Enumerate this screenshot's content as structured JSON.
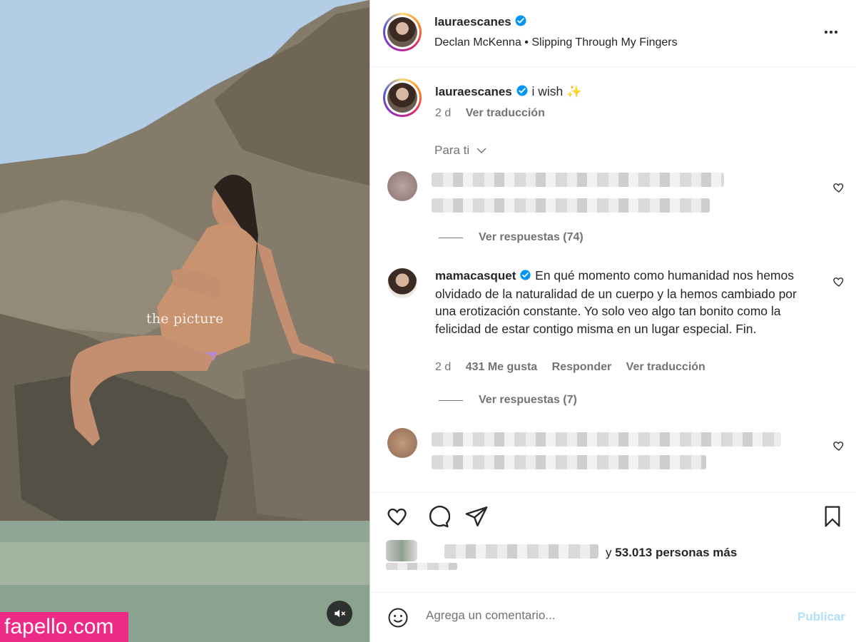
{
  "media": {
    "overlay_text": "the picture",
    "watermark": "fapello.com",
    "mute_icon": "speaker-muted-icon"
  },
  "header": {
    "username": "lauraescanes",
    "song": "Declan McKenna • Slipping Through My Fingers",
    "more_icon": "more-dots-icon"
  },
  "caption": {
    "username": "lauraescanes",
    "text": "i wish ✨",
    "time": "2 d",
    "translate": "Ver traducción"
  },
  "filter_label": "Para ti",
  "comments": [
    {
      "blurred": true,
      "view_replies": "Ver respuestas (74)"
    },
    {
      "username": "mamacasquet",
      "text": "En qué momento como humanidad nos hemos olvidado de la naturalidad de un cuerpo y la hemos cambiado por una erotización constante. Yo solo veo algo tan bonito como la felicidad de estar contigo misma en un lugar especial. Fin.",
      "time": "2 d",
      "likes": "431 Me gusta",
      "reply": "Responder",
      "translate": "Ver traducción",
      "view_replies": "Ver respuestas (7)"
    },
    {
      "blurred": true
    }
  ],
  "likes": {
    "suffix": "y",
    "count_text": "53.013 personas más"
  },
  "add_comment": {
    "placeholder": "Agrega un comentario...",
    "publish": "Publicar"
  },
  "colors": {
    "verified": "#0095f6",
    "publish_disabled": "#b2dffc",
    "watermark_bg": "#ee2a88"
  }
}
